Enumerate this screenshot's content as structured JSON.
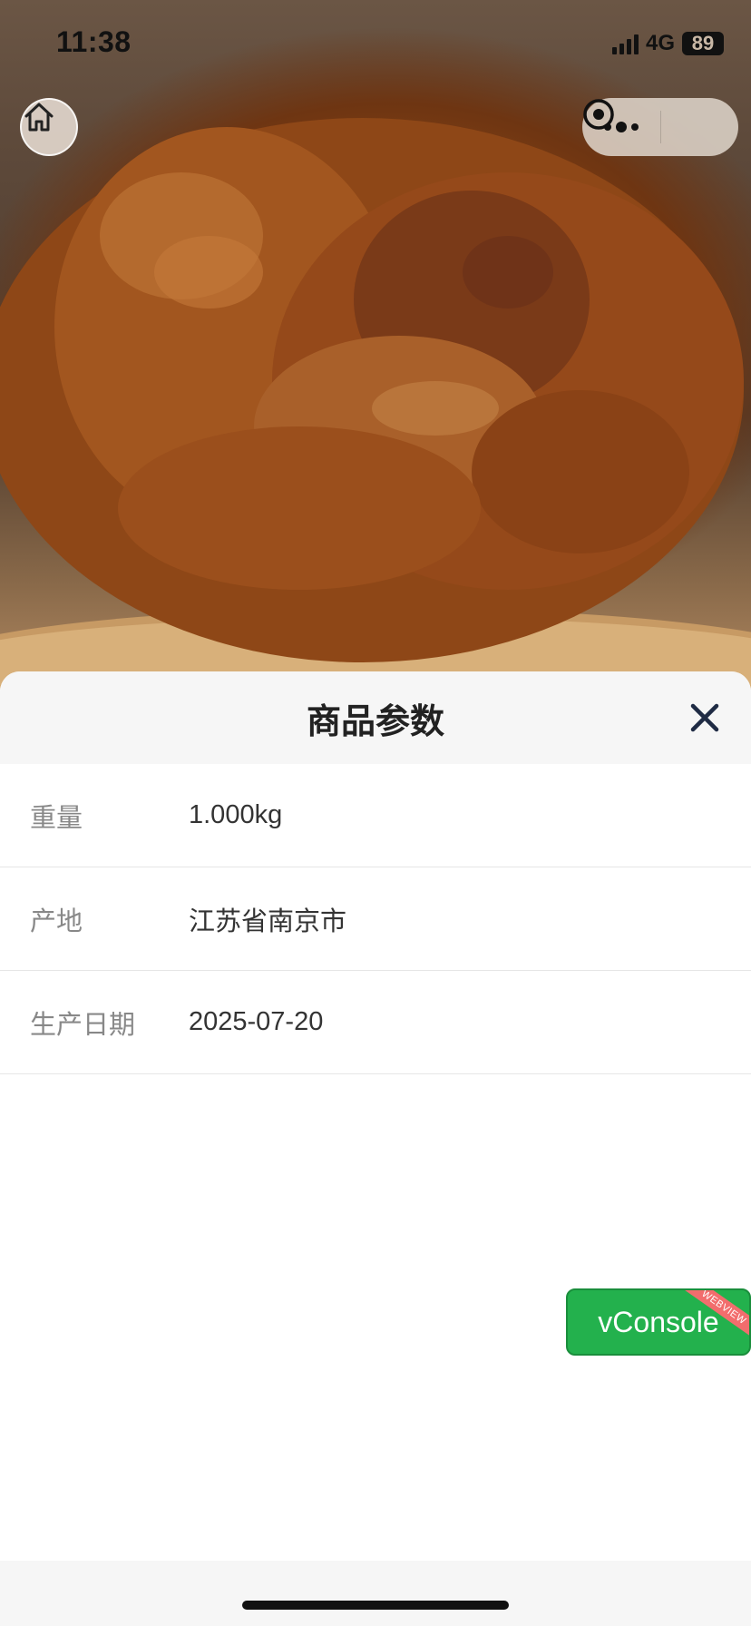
{
  "status_bar": {
    "time": "11:38",
    "network": "4G",
    "battery": "89"
  },
  "nav": {
    "home_icon": "home-icon",
    "more_icon": "more-dots-icon",
    "capsule_close_icon": "target-circle-icon"
  },
  "photo": {
    "subject": "roast-duck-photo"
  },
  "sheet": {
    "title": "商品参数",
    "close_icon": "close-x-icon",
    "rows": [
      {
        "label": "重量",
        "value": "1.000kg"
      },
      {
        "label": "产地",
        "value": "江苏省南京市"
      },
      {
        "label": "生产日期",
        "value": "2025-07-20"
      }
    ]
  },
  "vconsole": {
    "label": "vConsole",
    "badge": "WEBVIEW",
    "color": "#23b14d"
  }
}
